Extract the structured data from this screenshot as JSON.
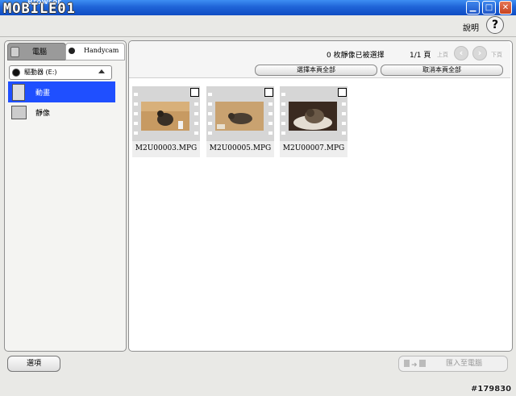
{
  "window": {
    "logo": "MOBILE01",
    "title": "Browser",
    "minimize": "▁",
    "maximize": "□",
    "close": "✕"
  },
  "help": {
    "label": "說明",
    "icon": "?"
  },
  "left": {
    "tab_computer": "電腦",
    "tab_handycam": "Handycam",
    "drive": "驅動器 (E:)",
    "items": [
      {
        "label": "動畫"
      },
      {
        "label": "靜像"
      }
    ],
    "options_button": "選項"
  },
  "main": {
    "status": "0 枚靜像已被選擇",
    "page": "1/1 頁",
    "prev_label": "上頁",
    "next_label": "下頁",
    "select_all": "選擇本頁全部",
    "deselect_all": "取消本頁全部",
    "files": [
      {
        "name": "M2U00003.MPG"
      },
      {
        "name": "M2U00005.MPG"
      },
      {
        "name": "M2U00007.MPG"
      }
    ],
    "import_button": "匯入至電腦"
  },
  "watermark": "#179830"
}
